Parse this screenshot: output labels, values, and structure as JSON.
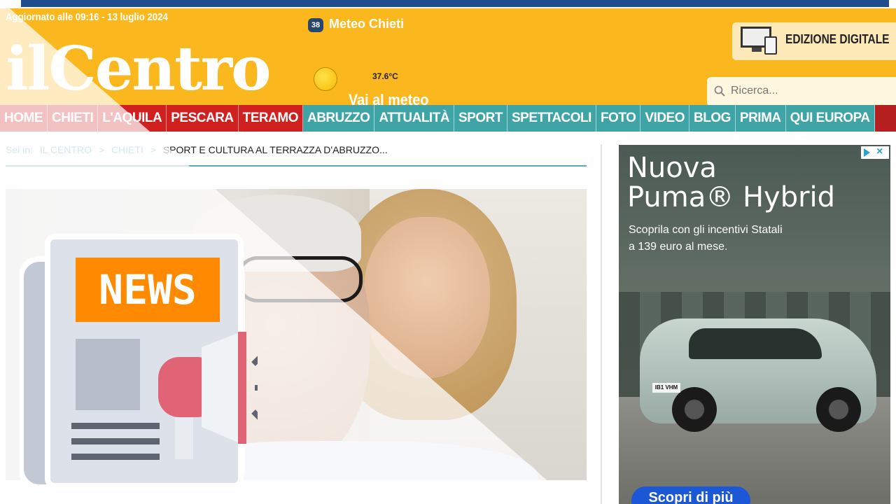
{
  "header": {
    "updated": "Aggiornato alle 09:16 - 13 luglio 2024",
    "logo_il": "il",
    "logo_centro": "Centro",
    "meteo": {
      "badge": "38",
      "title": "Meteo Chieti",
      "temperature": "37.6°C",
      "link": "Vai al meteo",
      "icon": "sun-icon"
    },
    "edition_label": "EDIZIONE DIGITALE",
    "search_placeholder": "Ricerca..."
  },
  "nav": {
    "items": [
      {
        "label": "HOME",
        "style": "red"
      },
      {
        "label": "CHIETI",
        "style": "red"
      },
      {
        "label": "L'AQUILA",
        "style": "red"
      },
      {
        "label": "PESCARA",
        "style": "red"
      },
      {
        "label": "TERAMO",
        "style": "red"
      },
      {
        "label": "ABRUZZO",
        "style": "teal"
      },
      {
        "label": "ATTUALITÀ",
        "style": "teal"
      },
      {
        "label": "SPORT",
        "style": "teal"
      },
      {
        "label": "SPETTACOLI",
        "style": "teal"
      },
      {
        "label": "FOTO",
        "style": "teal"
      },
      {
        "label": "VIDEO",
        "style": "teal"
      },
      {
        "label": "BLOG",
        "style": "teal"
      },
      {
        "label": "PRIMA",
        "style": "teal"
      },
      {
        "label": "QUI EUROPA",
        "style": "teal"
      }
    ]
  },
  "breadcrumb": {
    "label": "Sei in:",
    "items": [
      "IL CENTRO",
      "CHIETI"
    ],
    "separator": ">",
    "current": "SPORT E CULTURA AL TERRAZZA D'ABRUZZO..."
  },
  "overlay": {
    "badge_text": "NEWS"
  },
  "ad": {
    "title_line1": "Nuova",
    "title_line2": "Puma® Hybrid",
    "subtitle_line1": "Scoprila con gli incentivi Statali",
    "subtitle_line2": "a 139 euro al mese.",
    "cta": "Scopri di più",
    "plate": "IB1 VHM"
  },
  "colors": {
    "header_bg": "#fab81e",
    "nav_bg": "#b51f1f",
    "nav_red": "#d12020",
    "nav_teal": "#3ea4a6",
    "top_strip": "#1f4c8c",
    "news_orange": "#ff8a00",
    "cta_blue": "#1c57d6"
  }
}
